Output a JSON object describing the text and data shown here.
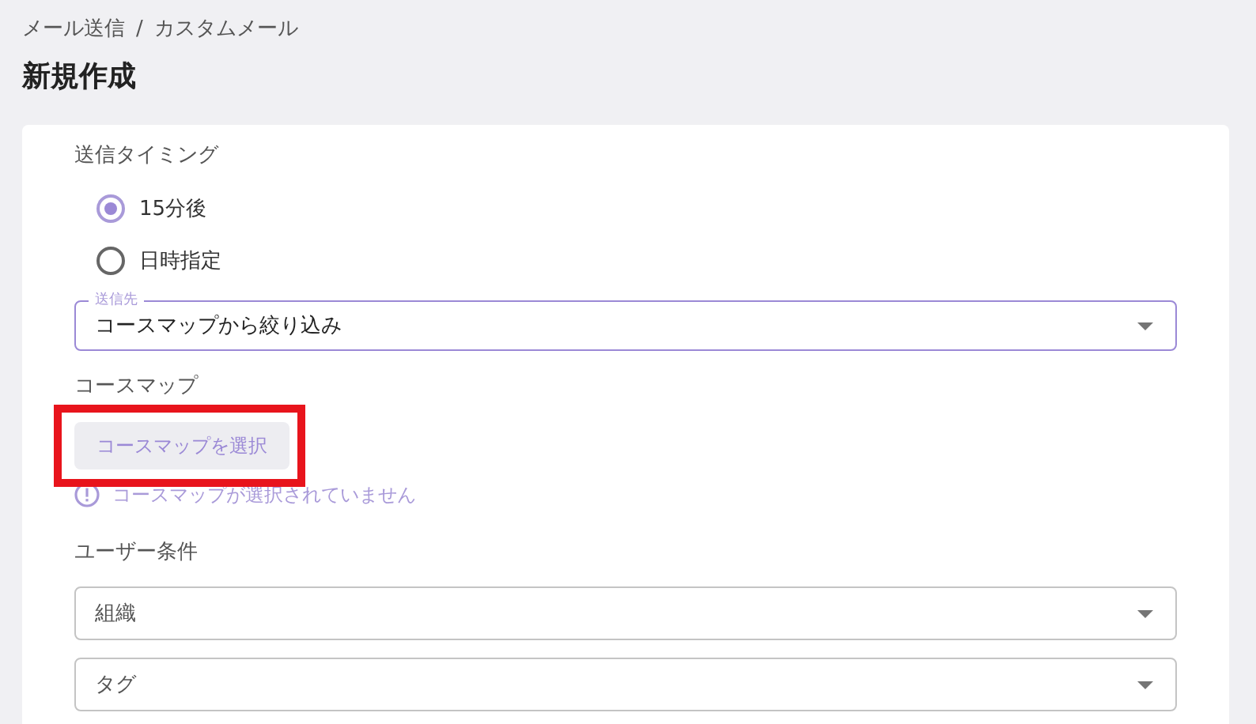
{
  "breadcrumb": [
    "メール送信",
    "カスタムメール"
  ],
  "breadcrumb_separator": "/",
  "title": "新規作成",
  "timing": {
    "label": "送信タイミング",
    "options": [
      {
        "label": "15分後",
        "selected": true
      },
      {
        "label": "日時指定",
        "selected": false
      }
    ]
  },
  "recipient": {
    "label": "送信先",
    "value": "コースマップから絞り込み",
    "focused": true
  },
  "course_map": {
    "label": "コースマップ",
    "button": "コースマップを選択",
    "highlighted": true,
    "disabled": true,
    "message": "コースマップが選択されていません"
  },
  "user_conditions": {
    "label": "ユーザー条件",
    "fields": [
      {
        "placeholder": "組織"
      },
      {
        "placeholder": "タグ"
      }
    ]
  }
}
